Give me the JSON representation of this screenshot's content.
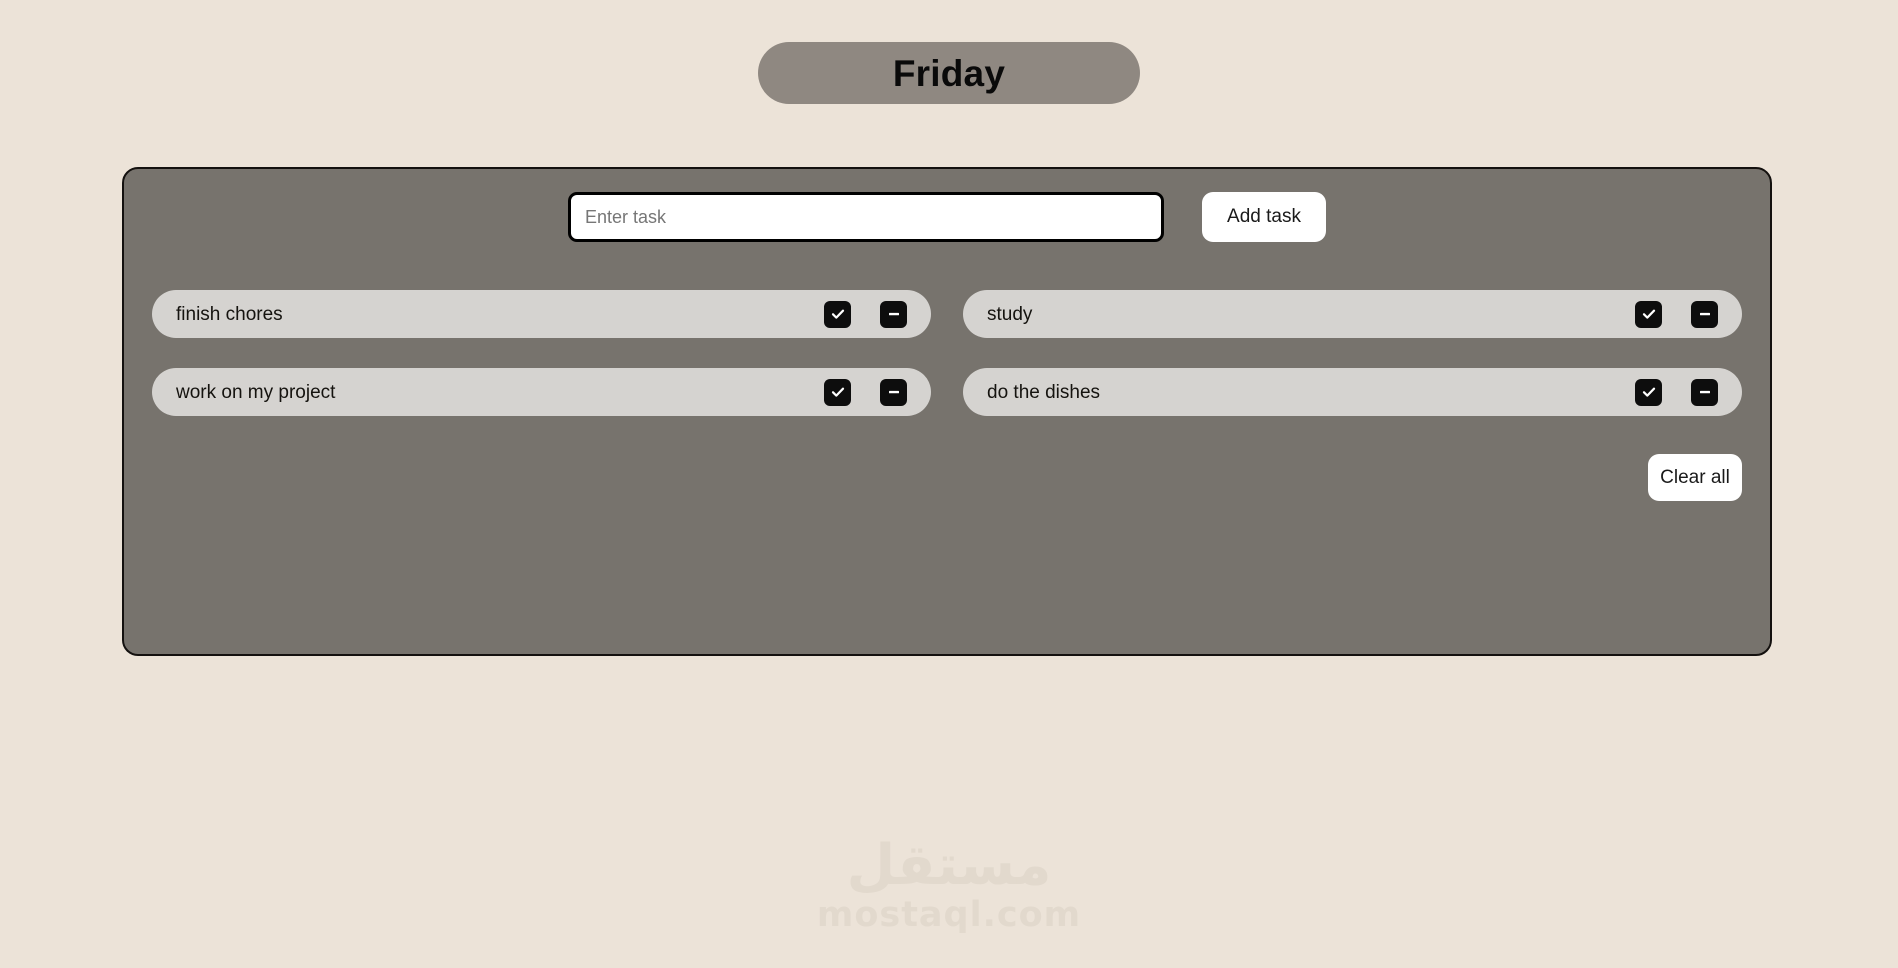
{
  "page": {
    "background_color": "#ece3d8",
    "title_text": "Friday"
  },
  "header": {
    "title": "Friday",
    "pill_color": "#8f8881"
  },
  "panel": {
    "background_color": "#77736d",
    "border_color": "#14110f"
  },
  "compose": {
    "input_value": "",
    "input_placeholder": "Enter task",
    "add_button_label": "Add task"
  },
  "tasks": {
    "left_column": [
      {
        "label": "finish chores",
        "check_icon": "check-icon",
        "remove_icon": "minus-icon"
      },
      {
        "label": "work on my project",
        "check_icon": "check-icon",
        "remove_icon": "minus-icon"
      }
    ],
    "right_column": [
      {
        "label": "study",
        "check_icon": "check-icon",
        "remove_icon": "minus-icon"
      },
      {
        "label": "do the dishes",
        "check_icon": "check-icon",
        "remove_icon": "minus-icon"
      }
    ]
  },
  "footer": {
    "clear_all_label": "Clear all"
  },
  "watermark": {
    "arabic": "مستقل",
    "latin": "mostaql.com"
  },
  "colors": {
    "row_background": "#d5d3d0",
    "button_background": "#ffffff",
    "icon_button_background": "#0d0d0d",
    "text": "#15130f",
    "placeholder": "#767676"
  }
}
